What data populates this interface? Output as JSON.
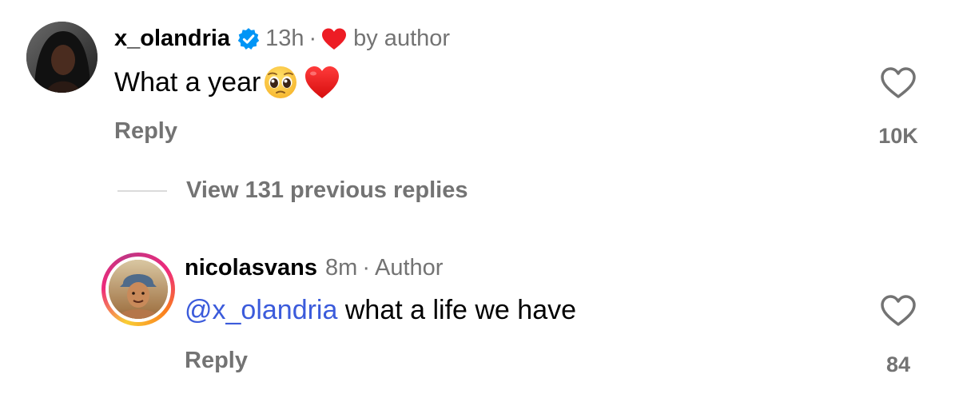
{
  "comments": [
    {
      "username": "x_olandria",
      "verified": true,
      "time": "13h",
      "separator": "·",
      "liked_by_author_label": "by author",
      "text": "What a year",
      "emoji": [
        "pleading-face",
        "red-heart"
      ],
      "reply_label": "Reply",
      "like_count": "10K"
    },
    {
      "username": "nicolasvans",
      "time": "8m",
      "separator": "·",
      "author_badge": "Author",
      "mention": "@x_olandria",
      "text": " what a life we have",
      "reply_label": "Reply",
      "like_count": "84"
    }
  ],
  "view_replies_label": "View 131 previous replies",
  "colors": {
    "secondary_text": "#737373",
    "mention": "#3b5bdb",
    "heart_red": "#ed1c24",
    "verified_blue": "#0095f6"
  }
}
